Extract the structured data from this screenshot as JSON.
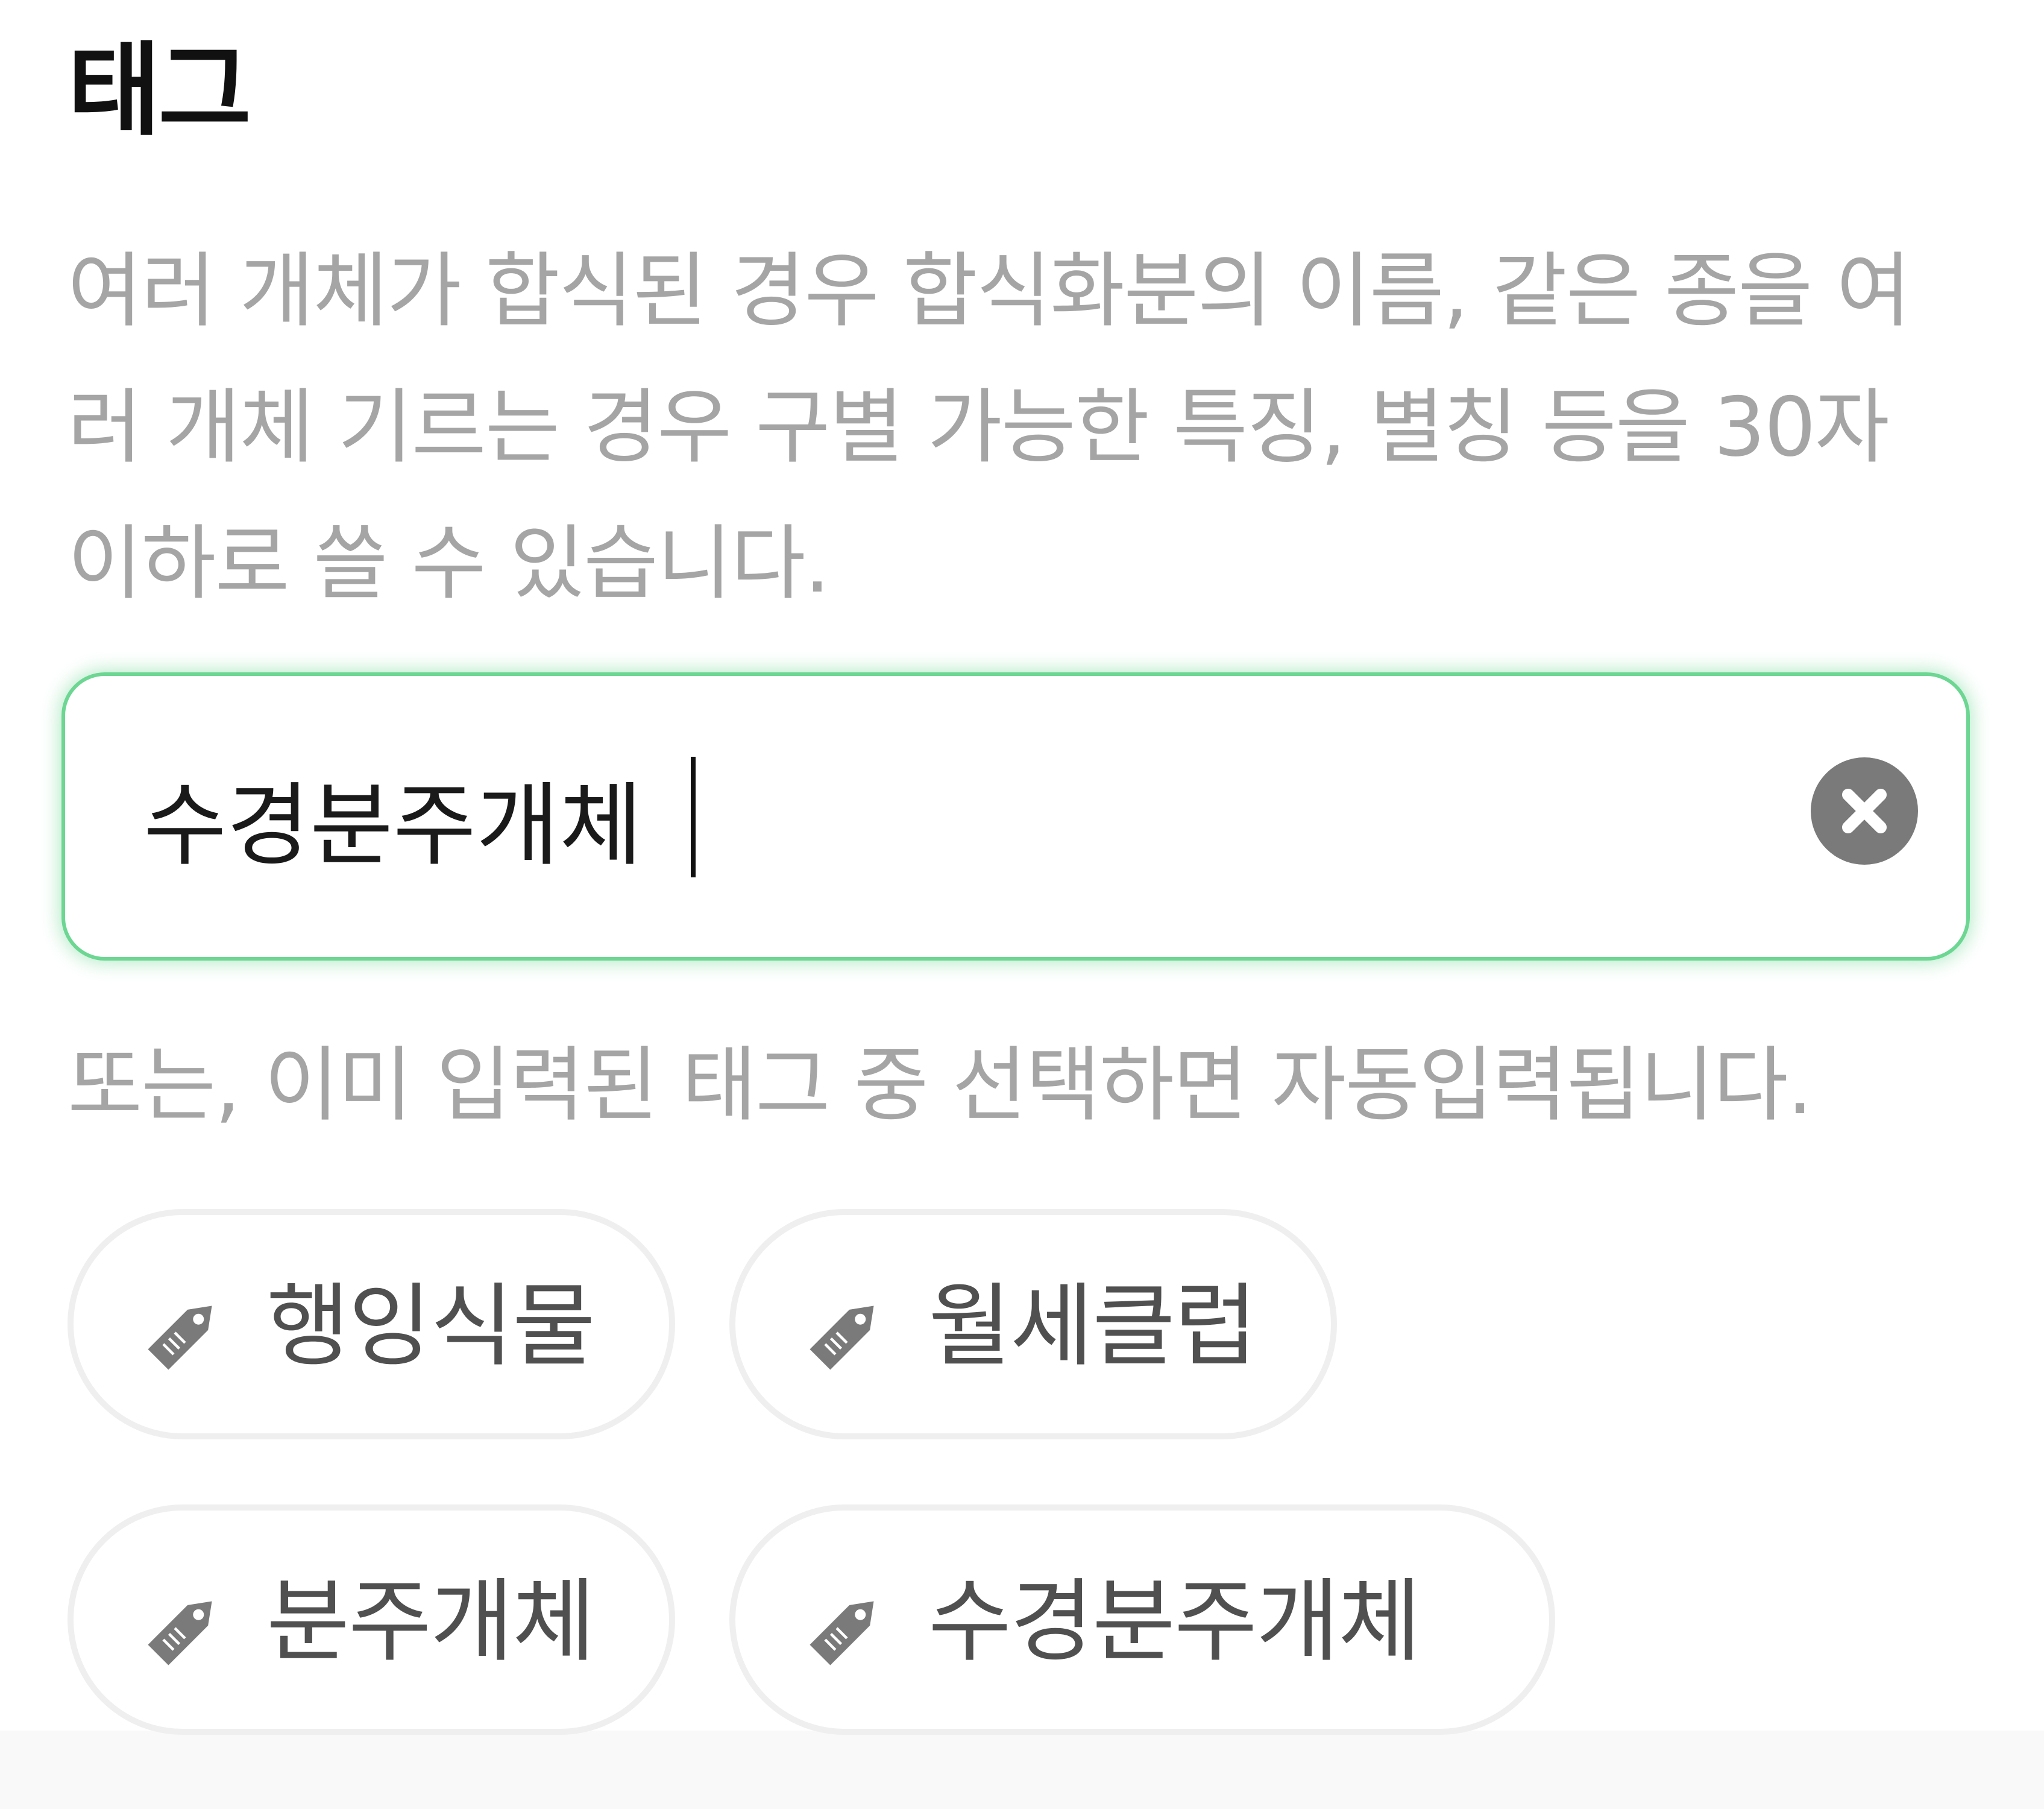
{
  "section": {
    "title": "태그",
    "description": "여러 개체가 합식된 경우 합식화분의 이름, 같은 종을 여러 개체 기르는 경우 구별 가능한 특징, 별칭 등을 30자 이하로 쓸 수 있습니다."
  },
  "input": {
    "value": "수경분주개체",
    "clear_icon": "clear-circle-x-icon"
  },
  "hint": "또는, 이미 입력된 태그 중 선택하면 자동입력됩니다.",
  "tags": [
    {
      "label": "행잉식물",
      "icon": "tag-icon"
    },
    {
      "label": "월세클럽",
      "icon": "tag-icon"
    },
    {
      "label": "분주개체",
      "icon": "tag-icon"
    },
    {
      "label": "수경분주개체",
      "icon": "tag-icon"
    }
  ],
  "colors": {
    "focus_border": "#6cd692",
    "muted_text": "#a5a5a5",
    "chip_border": "#efefef",
    "icon_gray": "#7a7a7a"
  }
}
